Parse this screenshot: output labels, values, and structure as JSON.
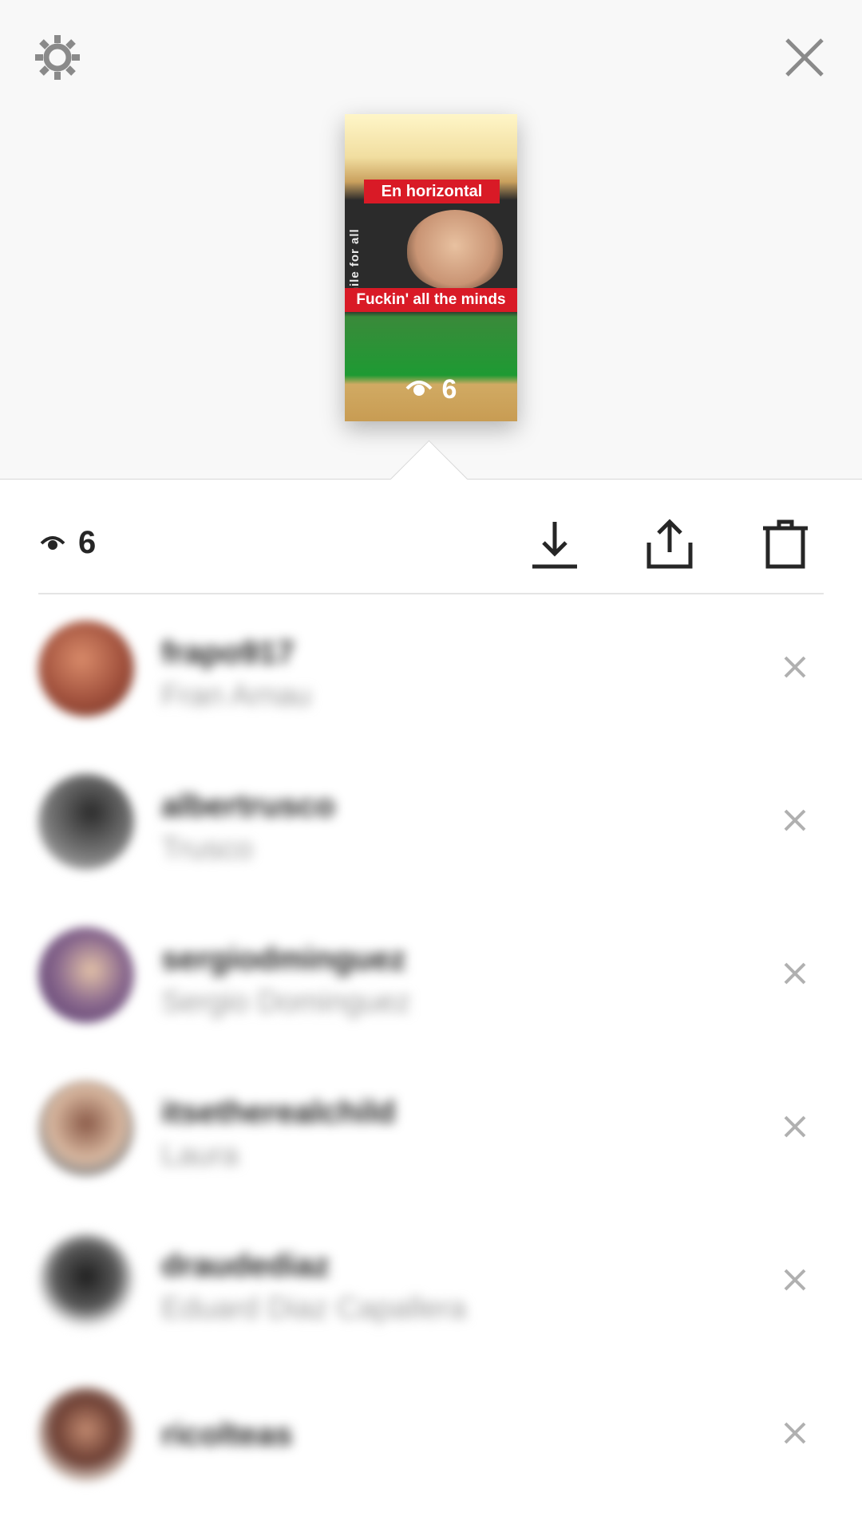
{
  "story": {
    "caption_top": "En horizontal",
    "caption_bottom": "Fuckin' all the minds",
    "shirt_text": "Chile for all",
    "view_count": "6"
  },
  "stats": {
    "view_count": "6"
  },
  "actions": {
    "download_icon": "download-icon",
    "share_icon": "share-icon",
    "delete_icon": "trash-icon"
  },
  "viewers": [
    {
      "username": "frapo917",
      "fullname": "Fran Arnau",
      "avatar_color": "#a0503c"
    },
    {
      "username": "albertrusco",
      "fullname": "Trusco",
      "avatar_color": "#777777"
    },
    {
      "username": "sergiodminguez",
      "fullname": "Sergio Dominguez",
      "avatar_color": "#6a4a7e"
    },
    {
      "username": "itsetherealchild",
      "fullname": "Laura",
      "avatar_color": "#b7876e"
    },
    {
      "username": "draudediaz",
      "fullname": "Eduard Diaz Capallera",
      "avatar_color": "#2e2e2e"
    },
    {
      "username": "ricolteas",
      "fullname": "",
      "avatar_color": "#6b3d32"
    }
  ],
  "colors": {
    "caption_bg": "#d91a26",
    "remove_x": "#b0b0b0",
    "top_bg": "#f8f8f8"
  }
}
